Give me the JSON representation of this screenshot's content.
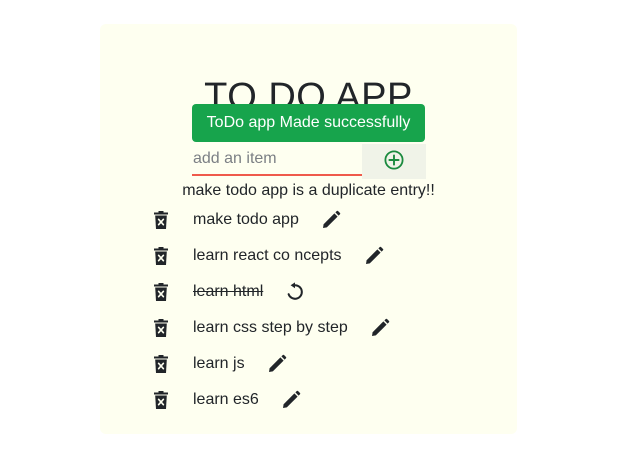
{
  "app": {
    "title": "TO DO APP",
    "toast_message": "ToDo app Made successfully",
    "input_placeholder": "add an item",
    "input_value": "",
    "duplicate_message": "make todo app is a duplicate entry!!"
  },
  "todos": [
    {
      "text": "make todo app",
      "completed": false,
      "action_icon": "edit-icon"
    },
    {
      "text": "learn react co ncepts",
      "completed": false,
      "action_icon": "edit-icon"
    },
    {
      "text": "learn html",
      "completed": true,
      "action_icon": "undo-icon"
    },
    {
      "text": "learn css step by step",
      "completed": false,
      "action_icon": "edit-icon"
    },
    {
      "text": "learn js",
      "completed": false,
      "action_icon": "edit-icon"
    },
    {
      "text": "learn es6",
      "completed": false,
      "action_icon": "edit-icon"
    }
  ],
  "colors": {
    "card_background": "#fefff0",
    "toast_background": "#17a44c",
    "input_underline": "#ef5a4b",
    "add_icon": "#1a8a3e",
    "add_button_background": "#f0f3e8"
  }
}
